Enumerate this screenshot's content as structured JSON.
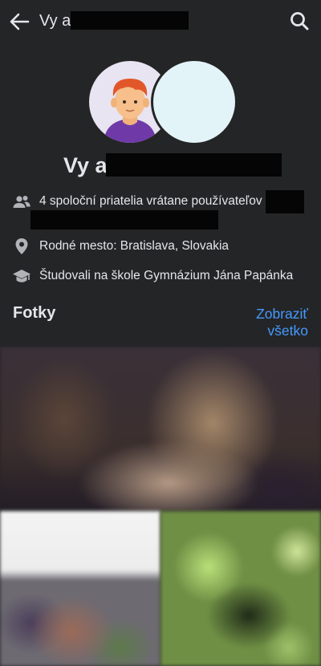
{
  "header": {
    "title": "Vy a",
    "back_icon": "back-arrow-icon",
    "search_icon": "search-icon"
  },
  "profile": {
    "names_prefix": "Vy a"
  },
  "info": {
    "mutual_friends": "4 spoloční priatelia vrátane používateľov",
    "hometown": "Rodné mesto: Bratislava, Slovakia",
    "education": "Študovali na škole Gymnázium Jána Papánka"
  },
  "photos": {
    "title": "Fotky",
    "see_all_line1": "Zobraziť",
    "see_all_line2": "všetko"
  },
  "colors": {
    "background": "#242526",
    "text": "#e4e6eb",
    "link": "#4599ff",
    "icon": "#b0b3b8"
  }
}
